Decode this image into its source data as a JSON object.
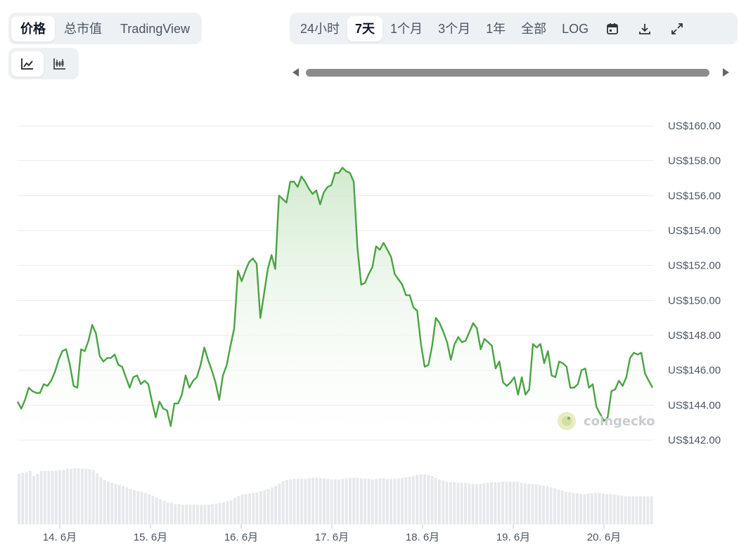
{
  "tabs_metric": [
    {
      "label": "价格",
      "active": true
    },
    {
      "label": "总市值",
      "active": false
    },
    {
      "label": "TradingView",
      "active": false
    }
  ],
  "chart_type_buttons": [
    {
      "icon": "line-chart-icon",
      "active": true
    },
    {
      "icon": "candlestick-icon",
      "active": false
    }
  ],
  "range_buttons": [
    {
      "label": "24小时",
      "active": false
    },
    {
      "label": "7天",
      "active": true
    },
    {
      "label": "1个月",
      "active": false
    },
    {
      "label": "3个月",
      "active": false
    },
    {
      "label": "1年",
      "active": false
    },
    {
      "label": "全部",
      "active": false
    },
    {
      "label": "LOG",
      "active": false
    }
  ],
  "tool_icons": [
    "calendar-icon",
    "download-icon",
    "fullscreen-icon"
  ],
  "watermark": "coingecko",
  "colors": {
    "line": "#4aa344",
    "area_top": "#cfe9cc",
    "grid": "#e8eaed",
    "volume": "#e6e8ec"
  },
  "chart_data": {
    "type": "area",
    "ylim": [
      141,
      161
    ],
    "yticks": [
      "US$160.00",
      "US$158.00",
      "US$156.00",
      "US$154.00",
      "US$152.00",
      "US$150.00",
      "US$148.00",
      "US$146.00",
      "US$144.00",
      "US$142.00"
    ],
    "ytick_values": [
      160,
      158,
      156,
      154,
      152,
      150,
      148,
      146,
      144,
      142
    ],
    "xticks": [
      "14. 6月",
      "15. 6月",
      "16. 6月",
      "17. 6月",
      "18. 6月",
      "19. 6月",
      "20. 6月"
    ],
    "price": [
      144.2,
      143.8,
      144.3,
      145.0,
      144.8,
      144.7,
      144.7,
      145.2,
      145.1,
      145.4,
      145.9,
      146.6,
      147.1,
      147.2,
      146.3,
      145.1,
      145.0,
      147.2,
      147.1,
      147.7,
      148.6,
      148.1,
      146.8,
      146.5,
      146.7,
      146.7,
      146.9,
      146.3,
      146.2,
      145.6,
      145.0,
      145.6,
      145.7,
      145.2,
      145.4,
      145.2,
      144.2,
      143.3,
      144.2,
      143.8,
      143.7,
      142.8,
      144.1,
      144.1,
      144.6,
      145.7,
      145.0,
      145.4,
      145.6,
      146.3,
      147.3,
      146.6,
      146.0,
      145.3,
      144.3,
      145.7,
      146.3,
      147.4,
      148.4,
      151.7,
      151.1,
      151.7,
      152.2,
      152.4,
      152.1,
      149.0,
      150.4,
      151.8,
      152.6,
      151.8,
      156.0,
      155.8,
      155.6,
      156.8,
      156.8,
      156.5,
      157.1,
      156.8,
      156.4,
      156.1,
      156.3,
      155.5,
      156.2,
      156.5,
      156.6,
      157.3,
      157.3,
      157.6,
      157.4,
      157.3,
      156.8,
      153.0,
      150.9,
      151.0,
      151.5,
      151.9,
      153.1,
      152.9,
      153.3,
      152.9,
      152.5,
      151.5,
      151.2,
      150.9,
      150.3,
      150.3,
      149.6,
      149.4,
      147.5,
      146.2,
      146.3,
      147.4,
      149.0,
      148.7,
      148.2,
      147.6,
      146.6,
      147.5,
      147.9,
      147.6,
      147.7,
      148.2,
      148.7,
      148.4,
      147.2,
      147.8,
      147.6,
      147.4,
      146.1,
      146.5,
      145.3,
      145.1,
      145.3,
      145.6,
      144.6,
      145.6,
      144.6,
      144.9,
      147.5,
      147.3,
      147.5,
      146.4,
      147.1,
      145.7,
      145.6,
      146.5,
      146.4,
      146.2,
      145.0,
      145.0,
      145.2,
      146.0,
      146.1,
      145.0,
      145.2,
      143.9,
      143.5,
      143.1,
      143.3,
      144.8,
      144.9,
      145.4,
      145.1,
      145.6,
      146.7,
      147.0,
      146.9,
      147.0,
      145.8,
      145.4,
      145.0
    ],
    "volume_relative": [
      0.9,
      0.92,
      0.93,
      0.95,
      0.86,
      0.9,
      0.95,
      0.95,
      0.95,
      0.95,
      0.96,
      0.97,
      0.97,
      0.99,
      0.99,
      1.0,
      1.0,
      0.99,
      0.99,
      0.98,
      0.97,
      0.91,
      0.84,
      0.79,
      0.76,
      0.74,
      0.72,
      0.7,
      0.68,
      0.66,
      0.63,
      0.61,
      0.59,
      0.58,
      0.56,
      0.54,
      0.51,
      0.48,
      0.45,
      0.42,
      0.39,
      0.38,
      0.36,
      0.36,
      0.35,
      0.35,
      0.35,
      0.35,
      0.35,
      0.35,
      0.35,
      0.35,
      0.36,
      0.37,
      0.38,
      0.39,
      0.41,
      0.43,
      0.47,
      0.5,
      0.53,
      0.54,
      0.55,
      0.56,
      0.57,
      0.59,
      0.61,
      0.63,
      0.66,
      0.69,
      0.73,
      0.77,
      0.79,
      0.8,
      0.81,
      0.81,
      0.81,
      0.81,
      0.82,
      0.83,
      0.83,
      0.82,
      0.82,
      0.81,
      0.8,
      0.8,
      0.8,
      0.81,
      0.82,
      0.83,
      0.83,
      0.83,
      0.82,
      0.81,
      0.81,
      0.8,
      0.81,
      0.82,
      0.82,
      0.81,
      0.81,
      0.81,
      0.82,
      0.83,
      0.84,
      0.85,
      0.86,
      0.88,
      0.89,
      0.89,
      0.88,
      0.86,
      0.83,
      0.8,
      0.78,
      0.76,
      0.75,
      0.75,
      0.74,
      0.74,
      0.74,
      0.73,
      0.72,
      0.72,
      0.72,
      0.73,
      0.74,
      0.75,
      0.75,
      0.75,
      0.76,
      0.76,
      0.76,
      0.76,
      0.76,
      0.74,
      0.73,
      0.72,
      0.72,
      0.71,
      0.7,
      0.69,
      0.68,
      0.66,
      0.64,
      0.62,
      0.6,
      0.58,
      0.57,
      0.56,
      0.55,
      0.54,
      0.54,
      0.55,
      0.55,
      0.56,
      0.56,
      0.55,
      0.54,
      0.54,
      0.53,
      0.52,
      0.51,
      0.5,
      0.5,
      0.5,
      0.5,
      0.5,
      0.5,
      0.5,
      0.5
    ]
  }
}
